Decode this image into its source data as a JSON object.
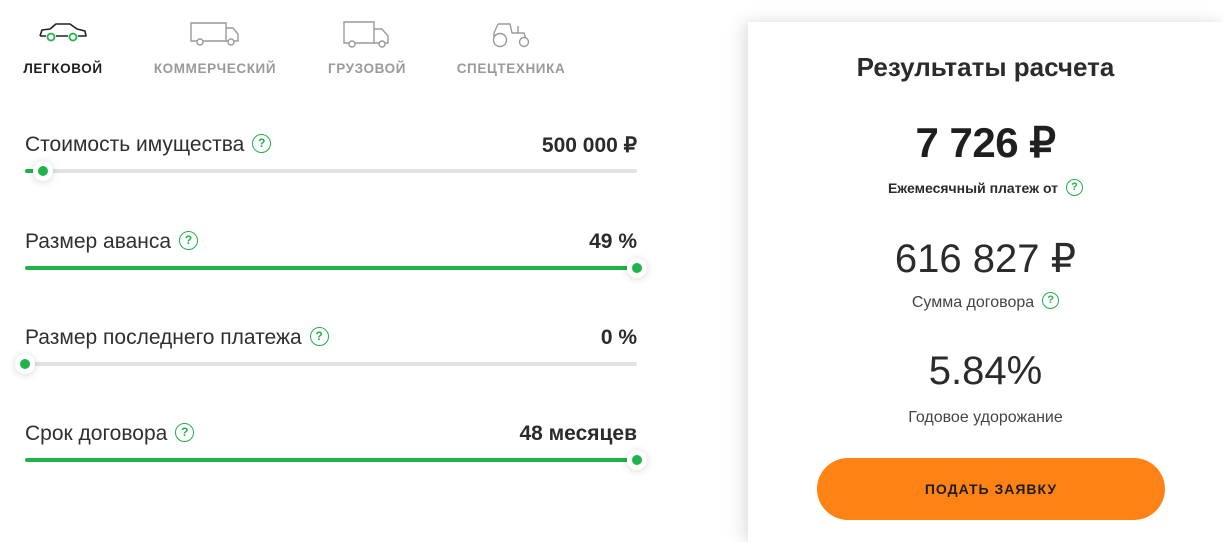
{
  "colors": {
    "accent": "#1fb34a",
    "button": "#ff8214",
    "track": "#e2e2e2"
  },
  "tabs": [
    {
      "label": "ЛЕГКОВОЙ",
      "icon": "car-icon",
      "active": true
    },
    {
      "label": "КОММЕРЧЕСКИЙ",
      "icon": "van-icon",
      "active": false
    },
    {
      "label": "ГРУЗОВОЙ",
      "icon": "truck-icon",
      "active": false
    },
    {
      "label": "СПЕЦТЕХНИКА",
      "icon": "tractor-icon",
      "active": false
    }
  ],
  "help_symbol": "?",
  "sliders": [
    {
      "label": "Стоимость имущества",
      "value": "500 000 ₽",
      "fraction": 0.03
    },
    {
      "label": "Размер аванса",
      "value": "49 %",
      "fraction": 1.0
    },
    {
      "label": "Размер последнего платежа",
      "value": "0 %",
      "fraction": 0.0
    },
    {
      "label": "Срок договора",
      "value": "48 месяцев",
      "fraction": 1.0
    }
  ],
  "results": {
    "title": "Результаты расчета",
    "monthly_value": "7 726 ₽",
    "monthly_label": "Ежемесячный платеж от",
    "contract_value": "616 827 ₽",
    "contract_label": "Сумма договора",
    "rate_value": "5.84%",
    "rate_label": "Годовое удорожание",
    "button_label": "ПОДАТЬ ЗАЯВКУ"
  }
}
